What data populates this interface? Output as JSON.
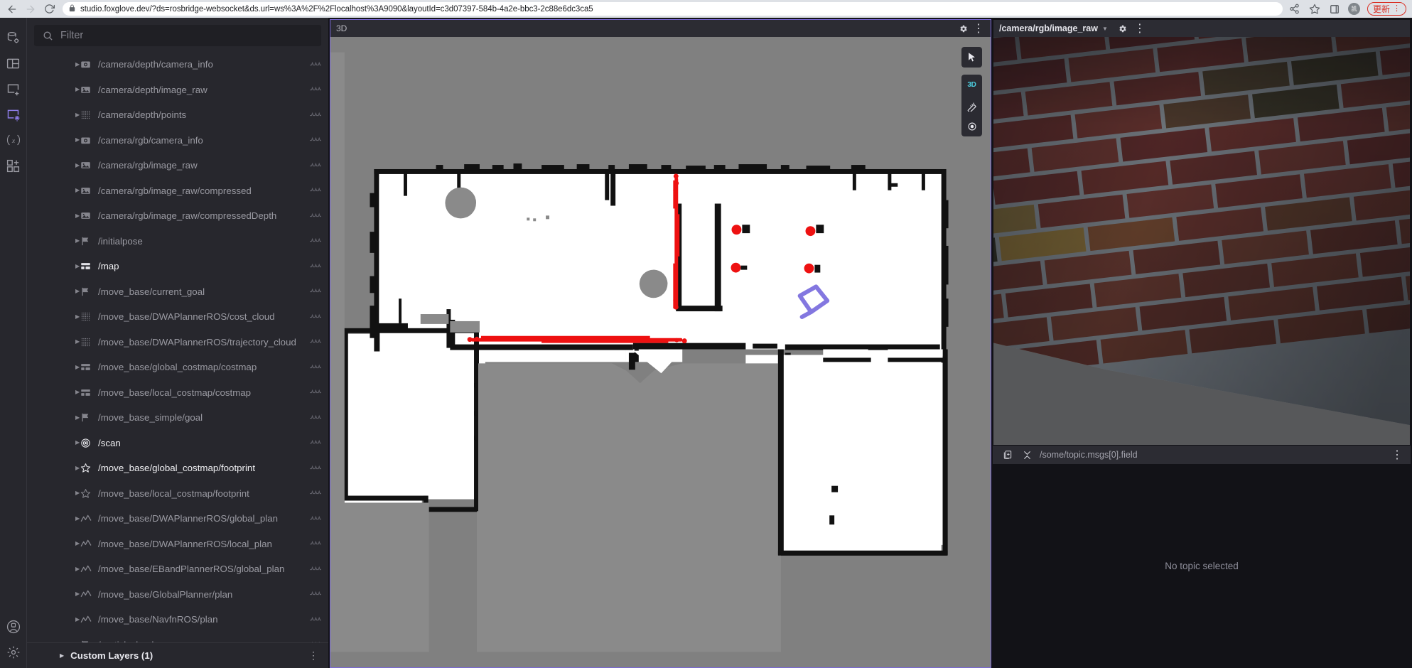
{
  "browser": {
    "back_icon": "back-arrow-icon",
    "forward_icon": "forward-arrow-icon",
    "reload_icon": "reload-icon",
    "lock_icon": "lock-icon",
    "url": "studio.foxglove.dev/?ds=rosbridge-websocket&ds.url=ws%3A%2F%2Flocalhost%3A9090&layoutId=c3d07397-584b-4a2e-bbc3-2c88e6dc3ca5",
    "share_icon": "share-icon",
    "bookmark_icon": "star-icon",
    "sidepanel_icon": "side-panel-icon",
    "avatar_initial": "凯",
    "update_label": "更新",
    "menu_dots": "⋮",
    "update_color": "#d93025"
  },
  "rail": {
    "items": [
      {
        "name": "data-source",
        "icon": "database-gear-icon",
        "active": false
      },
      {
        "name": "layouts",
        "icon": "layout-grid-icon",
        "active": false
      },
      {
        "name": "add-panel",
        "icon": "panel-add-icon",
        "active": false
      },
      {
        "name": "panel-settings",
        "icon": "panel-gear-icon",
        "active": true
      },
      {
        "name": "variables",
        "icon": "variable-x-icon",
        "active": false
      },
      {
        "name": "extensions",
        "icon": "extensions-add-icon",
        "active": false
      }
    ],
    "account_icon": "account-circle-icon",
    "preferences_icon": "gear-icon",
    "active_color": "#8d7ce8"
  },
  "sidebar": {
    "filter": {
      "placeholder": "Filter",
      "value": "",
      "icon": "search-icon"
    },
    "topics": [
      {
        "label": "/camera/depth/camera_info",
        "icon": "camera-icon",
        "enabled": false
      },
      {
        "label": "/camera/depth/image_raw",
        "icon": "image-icon",
        "enabled": false
      },
      {
        "label": "/camera/depth/points",
        "icon": "pointcloud-icon",
        "enabled": false
      },
      {
        "label": "/camera/rgb/camera_info",
        "icon": "camera-icon",
        "enabled": false
      },
      {
        "label": "/camera/rgb/image_raw",
        "icon": "image-icon",
        "enabled": false
      },
      {
        "label": "/camera/rgb/image_raw/compressed",
        "icon": "image-icon",
        "enabled": false
      },
      {
        "label": "/camera/rgb/image_raw/compressedDepth",
        "icon": "image-icon",
        "enabled": false
      },
      {
        "label": "/initialpose",
        "icon": "flag-icon",
        "enabled": false
      },
      {
        "label": "/map",
        "icon": "grid-map-icon",
        "enabled": true
      },
      {
        "label": "/move_base/current_goal",
        "icon": "flag-icon",
        "enabled": false
      },
      {
        "label": "/move_base/DWAPlannerROS/cost_cloud",
        "icon": "pointcloud-icon",
        "enabled": false
      },
      {
        "label": "/move_base/DWAPlannerROS/trajectory_cloud",
        "icon": "pointcloud-icon",
        "enabled": false
      },
      {
        "label": "/move_base/global_costmap/costmap",
        "icon": "grid-map-icon",
        "enabled": false
      },
      {
        "label": "/move_base/local_costmap/costmap",
        "icon": "grid-map-icon",
        "enabled": false
      },
      {
        "label": "/move_base_simple/goal",
        "icon": "flag-icon",
        "enabled": false
      },
      {
        "label": "/scan",
        "icon": "laserscan-icon",
        "enabled": true
      },
      {
        "label": "/move_base/global_costmap/footprint",
        "icon": "polygon-star-icon",
        "enabled": true
      },
      {
        "label": "/move_base/local_costmap/footprint",
        "icon": "polygon-star-icon",
        "enabled": false
      },
      {
        "label": "/move_base/DWAPlannerROS/global_plan",
        "icon": "path-line-icon",
        "enabled": false
      },
      {
        "label": "/move_base/DWAPlannerROS/local_plan",
        "icon": "path-line-icon",
        "enabled": false
      },
      {
        "label": "/move_base/EBandPlannerROS/global_plan",
        "icon": "path-line-icon",
        "enabled": false
      },
      {
        "label": "/move_base/GlobalPlanner/plan",
        "icon": "path-line-icon",
        "enabled": false
      },
      {
        "label": "/move_base/NavfnROS/plan",
        "icon": "path-line-icon",
        "enabled": false
      },
      {
        "label": "/particlecloud",
        "icon": "flag-icon",
        "enabled": false
      }
    ],
    "custom_layers": {
      "label": "Custom Layers (1)",
      "arrow": "▶",
      "more_icon": "more-vertical-icon"
    }
  },
  "panel_3d": {
    "title": "3D",
    "settings_icon": "gear-icon",
    "more_icon": "more-vertical-icon",
    "selected_border_color": "#7a68d8",
    "toolbar": {
      "pointer_icon": "cursor-pointer-icon",
      "mode_label": "3D",
      "mode_color": "#4dd0e1",
      "measure_icon": "ruler-icon",
      "publish_icon": "target-icon"
    },
    "scene": {
      "background_color": "#808080",
      "free_space_color": "#ffffff",
      "occupied_color": "#111111",
      "unknown_color": "#808080",
      "laser_scan_color": "#ee1111",
      "footprint_color": "#8377e0"
    }
  },
  "panel_image": {
    "topic": "/camera/rgb/image_raw",
    "caret_icon": "chevron-down-icon",
    "settings_icon": "gear-icon",
    "more_icon": "more-vertical-icon",
    "content_description": "brick-wall-camera-frame"
  },
  "panel_plot": {
    "copy_icon": "copy-icon",
    "collapse_icon": "collapse-icon",
    "path": "/some/topic.msgs[0].field",
    "more_icon": "more-vertical-icon",
    "empty_message": "No topic selected"
  }
}
